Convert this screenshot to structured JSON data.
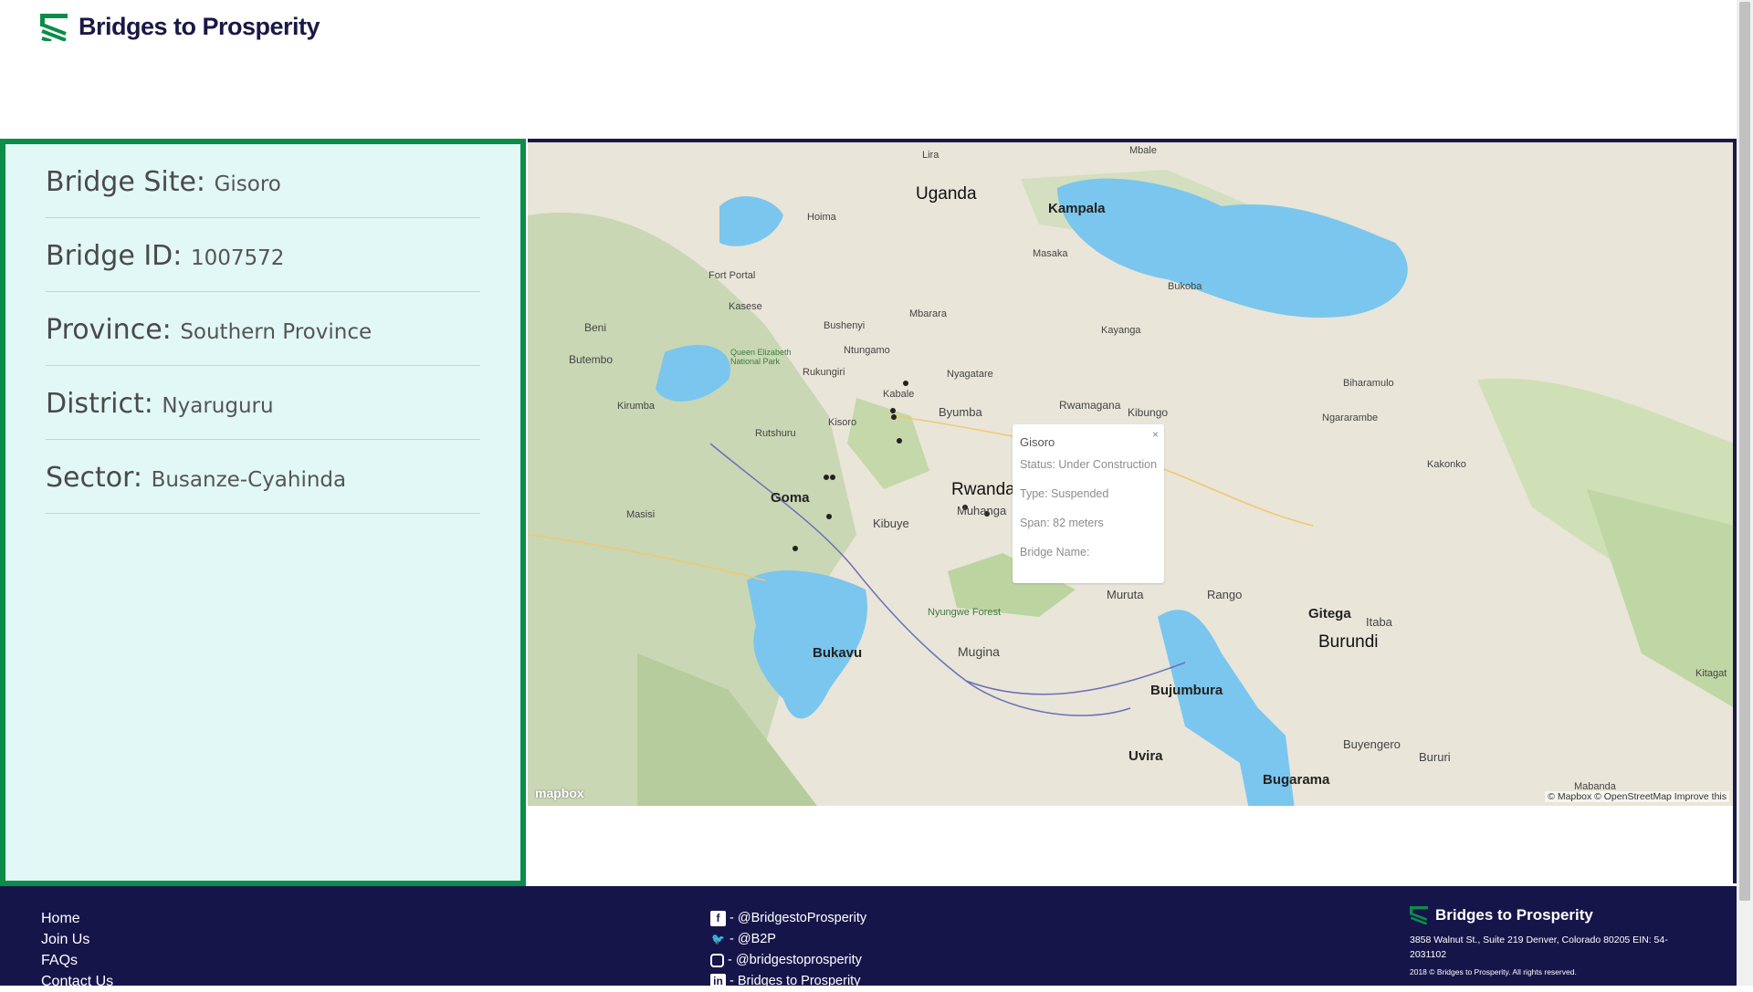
{
  "header": {
    "brand": "Bridges to Prosperity"
  },
  "bridge": {
    "site_label": "Bridge Site:",
    "site_value": "Gisoro",
    "id_label": "Bridge ID:",
    "id_value": "1007572",
    "province_label": "Province:",
    "province_value": "Southern Province",
    "district_label": "District:",
    "district_value": "Nyaruguru",
    "sector_label": "Sector:",
    "sector_value": "Busanze-Cyahinda"
  },
  "popup": {
    "title": "Gisoro",
    "status": "Status: Under Construction",
    "type": "Type: Suspended",
    "span": "Span: 82 meters",
    "name": "Bridge Name:",
    "close": "×"
  },
  "map": {
    "attribution": "© Mapbox © OpenStreetMap  Improve this",
    "logo": "mapbox",
    "labels": {
      "uganda": "Uganda",
      "rwanda": "Rwanda",
      "burundi": "Burundi",
      "kampala": "Kampala",
      "goma": "Goma",
      "bukavu": "Bukavu",
      "bujumbura": "Bujumbura",
      "uvira": "Uvira",
      "gitega": "Gitega",
      "kibuye": "Kibuye",
      "muhanga": "Muhanga",
      "byumba": "Byumba",
      "rwamagana": "Rwamagana",
      "kibungo": "Kibungo",
      "muruta": "Muruta",
      "rango": "Rango",
      "itaba": "Itaba",
      "mugina": "Mugina",
      "bugarama": "Bugarama",
      "buyengero": "Buyengero",
      "bururi": "Bururi",
      "butembo": "Butembo",
      "beni": "Beni",
      "kisoro": "Kisoro",
      "kabale": "Kabale",
      "rutshuru": "Rutshuru",
      "masisi": "Masisi",
      "kirumba": "Kirumba",
      "nyungwe": "Nyungwe Forest",
      "qenp": "Queen Elizabeth National Park",
      "bukoba": "Bukoba",
      "mbarara": "Mbarara",
      "kasese": "Kasese",
      "fortportal": "Fort Portal",
      "hoima": "Hoima",
      "masaka": "Masaka",
      "kayanga": "Kayanga",
      "biharamulo": "Biharamulo",
      "ngara": "Ngararambe",
      "kakonko": "Kakonko",
      "kitagata": "Kitagat",
      "mabanda": "Mabanda",
      "ntungamo": "Ntungamo",
      "bushenyi": "Bushenyi",
      "nyagatare": "Nyagatare",
      "rukungiri": "Rukungiri",
      "mbale": "Mbale",
      "lira": "Lira"
    }
  },
  "footer": {
    "links": [
      "Home",
      "Join Us",
      "FAQs",
      "Contact Us"
    ],
    "social": {
      "facebook": "- @BridgestoProsperity",
      "twitter": "- @B2P",
      "instagram": "- @bridgestoprosperity",
      "linkedin": "- Bridges to Prosperity"
    },
    "brand": "Bridges to Prosperity",
    "address": "3858 Walnut St., Suite 219 Denver, Colorado 80205 EIN: 54-2031102",
    "copyright": "2018 © Bridges to Prosperity. All rights reserved."
  },
  "colors": {
    "brand_green": "#0b8d49",
    "navy": "#16154a",
    "panel_bg": "#e2f8f6",
    "water": "#7ac6ee"
  }
}
